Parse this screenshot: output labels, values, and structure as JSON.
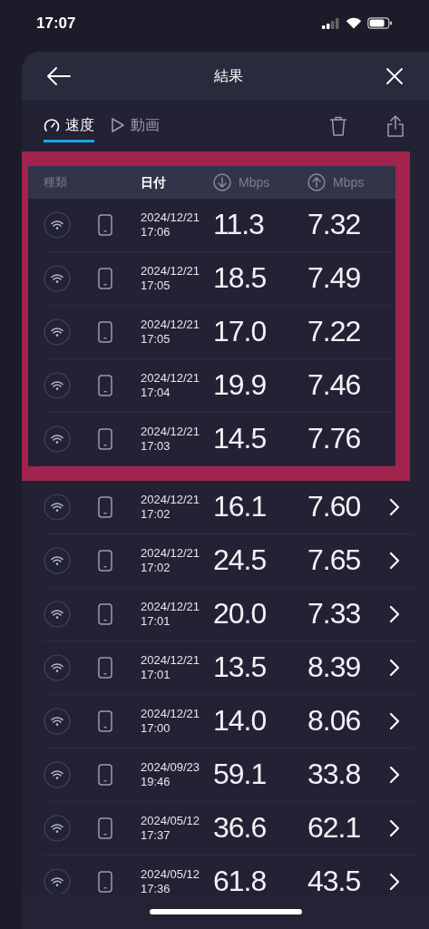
{
  "status_bar": {
    "time": "17:07"
  },
  "header": {
    "title": "結果"
  },
  "tabs": [
    {
      "label": "速度",
      "kind": "speed",
      "selected": true
    },
    {
      "label": "動画",
      "kind": "video",
      "selected": false
    }
  ],
  "table": {
    "columns": [
      {
        "label": "種類",
        "kind": "text",
        "emphasis": false
      },
      {
        "label": "日付",
        "kind": "text",
        "emphasis": true
      },
      {
        "label": "Mbps",
        "kind": "download"
      },
      {
        "label": "Mbps",
        "kind": "upload"
      }
    ],
    "highlighted_rows": [
      {
        "date": "2024/12/21",
        "time": "17:06",
        "download": "11.3",
        "upload": "7.32"
      },
      {
        "date": "2024/12/21",
        "time": "17:05",
        "download": "18.5",
        "upload": "7.49"
      },
      {
        "date": "2024/12/21",
        "time": "17:05",
        "download": "17.0",
        "upload": "7.22"
      },
      {
        "date": "2024/12/21",
        "time": "17:04",
        "download": "19.9",
        "upload": "7.46"
      },
      {
        "date": "2024/12/21",
        "time": "17:03",
        "download": "14.5",
        "upload": "7.76"
      }
    ],
    "rows": [
      {
        "date": "2024/12/21",
        "time": "17:02",
        "download": "16.1",
        "upload": "7.60"
      },
      {
        "date": "2024/12/21",
        "time": "17:02",
        "download": "24.5",
        "upload": "7.65"
      },
      {
        "date": "2024/12/21",
        "time": "17:01",
        "download": "20.0",
        "upload": "7.33"
      },
      {
        "date": "2024/12/21",
        "time": "17:01",
        "download": "13.5",
        "upload": "8.39"
      },
      {
        "date": "2024/12/21",
        "time": "17:00",
        "download": "14.0",
        "upload": "8.06"
      },
      {
        "date": "2024/09/23",
        "time": "19:46",
        "download": "59.1",
        "upload": "33.8"
      },
      {
        "date": "2024/05/12",
        "time": "17:37",
        "download": "36.6",
        "upload": "62.1"
      },
      {
        "date": "2024/05/12",
        "time": "17:36",
        "download": "61.8",
        "upload": "43.5"
      }
    ]
  }
}
